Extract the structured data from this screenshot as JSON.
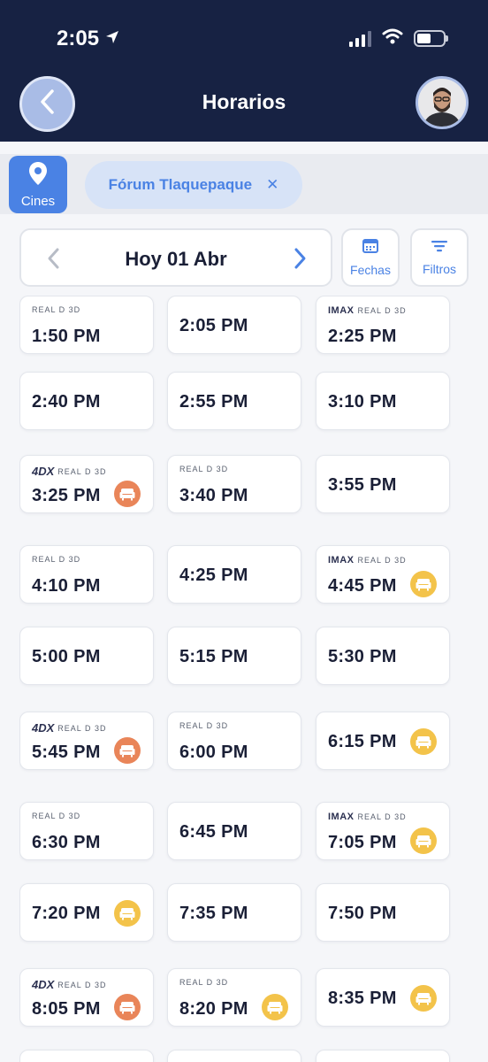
{
  "status": {
    "time": "2:05"
  },
  "header": {
    "title": "Horarios"
  },
  "cinema_bar": {
    "cines_label": "Cines",
    "selected_cinema": "Fórum Tlaquepaque",
    "remove_symbol": "✕"
  },
  "date_nav": {
    "label": "Hoy 01 Abr"
  },
  "buttons": {
    "dates_label": "Fechas",
    "filters_label": "Filtros"
  },
  "colors": {
    "header_bg": "#172243",
    "accent": "#4a82e4",
    "seat_orange": "#e98559",
    "seat_yellow": "#f3c34a"
  },
  "showtimes": [
    {
      "time": "1:50 PM",
      "formats": [
        "REAL D 3D"
      ],
      "seat": null
    },
    {
      "time": "2:05 PM",
      "formats": [],
      "seat": null
    },
    {
      "time": "2:25 PM",
      "formats": [
        "IMAX",
        "REAL D 3D"
      ],
      "seat": null
    },
    {
      "time": "2:40 PM",
      "formats": [],
      "seat": null
    },
    {
      "time": "2:55 PM",
      "formats": [],
      "seat": null
    },
    {
      "time": "3:10 PM",
      "formats": [],
      "seat": null
    },
    {
      "time": "3:25 PM",
      "formats": [
        "4DX",
        "REAL D 3D"
      ],
      "seat": "orange"
    },
    {
      "time": "3:40 PM",
      "formats": [
        "REAL D 3D"
      ],
      "seat": null
    },
    {
      "time": "3:55 PM",
      "formats": [],
      "seat": null
    },
    {
      "time": "4:10 PM",
      "formats": [
        "REAL D 3D"
      ],
      "seat": null
    },
    {
      "time": "4:25 PM",
      "formats": [],
      "seat": null
    },
    {
      "time": "4:45 PM",
      "formats": [
        "IMAX",
        "REAL D 3D"
      ],
      "seat": "yellow"
    },
    {
      "time": "5:00 PM",
      "formats": [],
      "seat": null
    },
    {
      "time": "5:15 PM",
      "formats": [],
      "seat": null
    },
    {
      "time": "5:30 PM",
      "formats": [],
      "seat": null
    },
    {
      "time": "5:45 PM",
      "formats": [
        "4DX",
        "REAL D 3D"
      ],
      "seat": "orange"
    },
    {
      "time": "6:00 PM",
      "formats": [
        "REAL D 3D"
      ],
      "seat": null
    },
    {
      "time": "6:15 PM",
      "formats": [],
      "seat": "yellow"
    },
    {
      "time": "6:30 PM",
      "formats": [
        "REAL D 3D"
      ],
      "seat": null
    },
    {
      "time": "6:45 PM",
      "formats": [],
      "seat": null
    },
    {
      "time": "7:05 PM",
      "formats": [
        "IMAX",
        "REAL D 3D"
      ],
      "seat": "yellow"
    },
    {
      "time": "7:20 PM",
      "formats": [],
      "seat": "yellow"
    },
    {
      "time": "7:35 PM",
      "formats": [],
      "seat": null
    },
    {
      "time": "7:50 PM",
      "formats": [],
      "seat": null
    },
    {
      "time": "8:05 PM",
      "formats": [
        "4DX",
        "REAL D 3D"
      ],
      "seat": "orange"
    },
    {
      "time": "8:20 PM",
      "formats": [
        "REAL D 3D"
      ],
      "seat": "yellow"
    },
    {
      "time": "8:35 PM",
      "formats": [],
      "seat": "yellow"
    }
  ]
}
